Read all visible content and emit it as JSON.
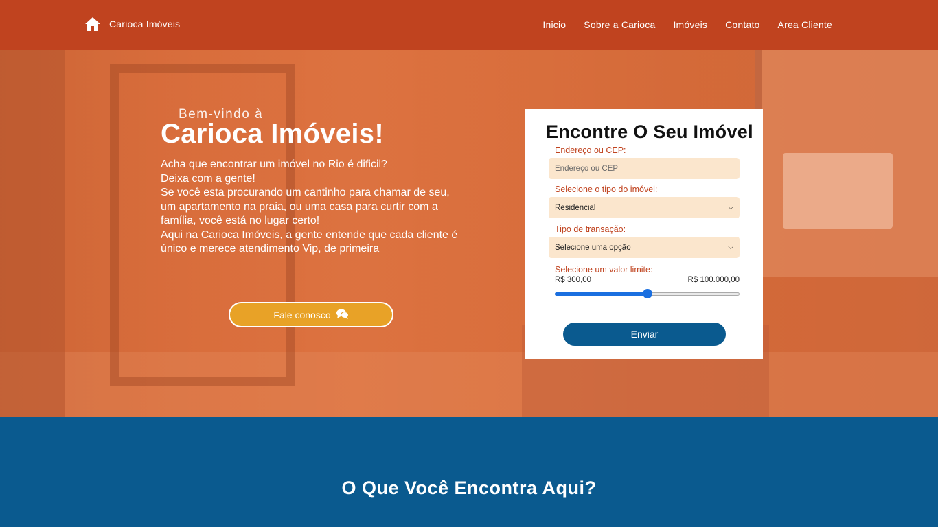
{
  "header": {
    "brand_name": "Carioca Imóveis",
    "brand_icon": "home-icon",
    "nav": [
      "Inicio",
      "Sobre a Carioca",
      "Imóveis",
      "Contato",
      "Area Cliente"
    ]
  },
  "hero": {
    "welcome": "Bem-vindo à",
    "title": "Carioca Imóveis!",
    "description": "Acha que encontrar um imóvel no Rio é dificil?\nDeixa com a gente!\nSe você esta procurando um cantinho para chamar de seu, um apartamento na praia, ou uma casa para curtir com a família, você está no lugar certo!\nAqui na Carioca Imóveis, a gente entende que cada cliente é único e merece atendimento Vip, de primeira",
    "cta_label": "Fale conosco",
    "cta_icon": "chat-bubbles-icon"
  },
  "search": {
    "title": "Encontre O Seu Imóvel",
    "address_label": "Endereço ou CEP:",
    "address_placeholder": "Endereço ou CEP",
    "type_label": "Selecione o tipo do imóvel:",
    "type_value": "Residencial",
    "transaction_label": "Tipo de transação:",
    "transaction_value": "Selecione uma opção",
    "price_label": "Selecione um valor limite:",
    "price_min": "R$ 300,00",
    "price_max": "R$ 100.000,00",
    "price_slider_fraction": 0.5,
    "submit_label": "Enviar"
  },
  "section": {
    "title": "O Que Você Encontra Aqui?"
  },
  "colors": {
    "header": "#c0431f",
    "accent_button": "#e8a227",
    "primary": "#0a5a8f",
    "field_bg": "#fbe6cd",
    "label": "#c0431f"
  }
}
